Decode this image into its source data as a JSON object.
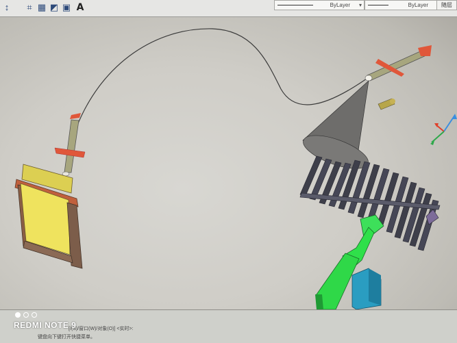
{
  "toolbar": {
    "icons": [
      {
        "name": "move-icon",
        "glyph": "↕"
      },
      {
        "name": "hatch-icon",
        "glyph": "⌗"
      },
      {
        "name": "gradient-icon",
        "glyph": "▦"
      },
      {
        "name": "region-icon",
        "glyph": "◩"
      },
      {
        "name": "table-icon",
        "glyph": "▣"
      },
      {
        "name": "multiline-text-icon",
        "glyph": "A"
      }
    ],
    "layer_combo_1": "ByLayer",
    "layer_combo_2": "ByLayer",
    "right_button": "随层"
  },
  "command_line": {
    "line_1": "[/(S)/窗口(W)/对象(O)] <实时>:",
    "line_2": "键盘向下键打开快捷菜单。"
  },
  "phone_watermark": "REDMI NOTE 9",
  "colors": {
    "fin_red": "#e0573a",
    "body_olive": "#a7a67e",
    "cone_gray": "#6e6d6b",
    "slat_dark": "#3e3f4a",
    "green_block": "#2fe04a",
    "cyan_block": "#2a9dc1",
    "yellow_panel": "#efe35e"
  }
}
